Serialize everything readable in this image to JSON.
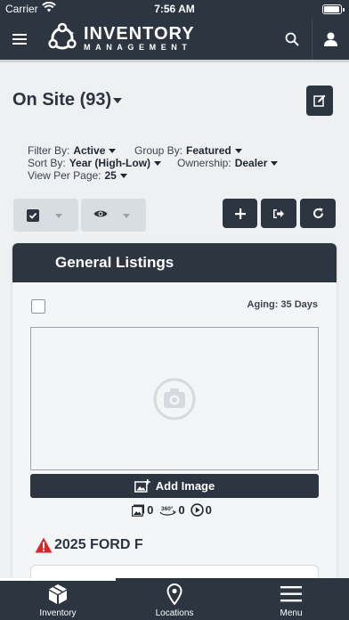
{
  "status_bar": {
    "carrier": "Carrier",
    "time": "7:56 AM"
  },
  "app": {
    "logo_line1": "INVENTORY",
    "logo_line2": "MANAGEMENT"
  },
  "header": {
    "title": "On Site (93)"
  },
  "filters": {
    "filter_by": {
      "label": "Filter By:",
      "value": "Active"
    },
    "group_by": {
      "label": "Group By:",
      "value": "Featured"
    },
    "sort_by": {
      "label": "Sort By:",
      "value": "Year (High-Low)"
    },
    "ownership": {
      "label": "Ownership:",
      "value": "Dealer"
    },
    "view_per_page": {
      "label": "View Per Page:",
      "value": "25"
    }
  },
  "panel": {
    "title": "General Listings",
    "aging": "Aging: 35 Days",
    "add_image_label": "Add Image",
    "media": {
      "photos": "0",
      "spins": "0",
      "videos": "0"
    },
    "vehicle_title": "2025 FORD F"
  },
  "tabs": [
    {
      "label": "Inventory",
      "icon": "cube-icon"
    },
    {
      "label": "Locations",
      "icon": "map-pin-icon"
    },
    {
      "label": "Menu",
      "icon": "menu-icon"
    }
  ],
  "colors": {
    "primary": "#2c3540",
    "background": "#eef0f2",
    "warning": "#d9272e"
  }
}
